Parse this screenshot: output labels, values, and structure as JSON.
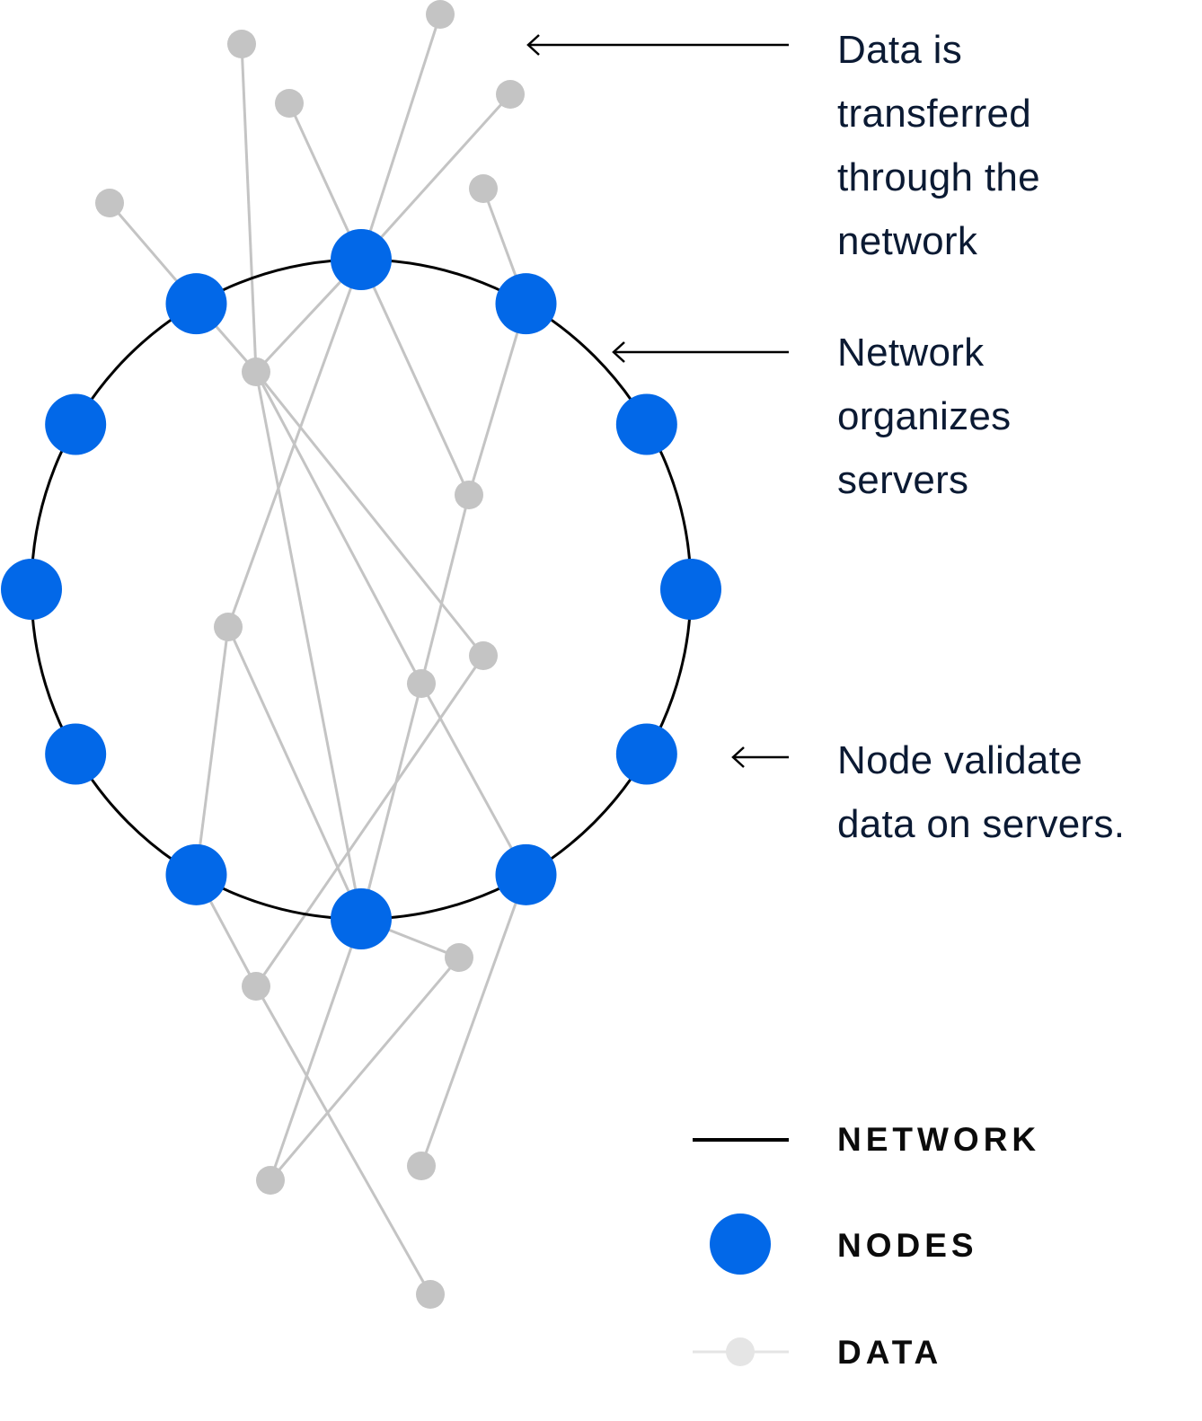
{
  "colors": {
    "network": "#000000",
    "node": "#0268E8",
    "data": "#C4C4C4",
    "data_legend": "#E5E5E5",
    "text": "#0B1A33"
  },
  "annotations": [
    {
      "name": "data-transfer",
      "lines": [
        "Data is",
        "transferred",
        "through the",
        "network"
      ]
    },
    {
      "name": "network-organizes",
      "lines": [
        "Network",
        "organizes",
        "servers"
      ]
    },
    {
      "name": "node-validate",
      "lines": [
        "Node validate",
        "data on servers."
      ]
    }
  ],
  "legend": [
    {
      "key": "network",
      "label": "NETWORK",
      "icon": "line"
    },
    {
      "key": "nodes",
      "label": "NODES",
      "icon": "dot"
    },
    {
      "key": "data",
      "label": "DATA",
      "icon": "line-dot"
    }
  ],
  "diagram": {
    "node_count": 12,
    "data_point_count": 16,
    "data_links": [
      [
        "D3",
        "N0"
      ],
      [
        "N0",
        "D8"
      ],
      [
        "D6",
        "N1"
      ],
      [
        "N1",
        "D8"
      ],
      [
        "D8",
        "D11"
      ],
      [
        "D4",
        "N0"
      ],
      [
        "N0",
        "D7"
      ],
      [
        "D1",
        "N0"
      ],
      [
        "N0",
        "D9"
      ],
      [
        "D5",
        "N11"
      ],
      [
        "N11",
        "D7"
      ],
      [
        "D2",
        "D7"
      ],
      [
        "D7",
        "N6"
      ],
      [
        "D7",
        "D11"
      ],
      [
        "D7",
        "D10"
      ],
      [
        "D9",
        "N7"
      ],
      [
        "D9",
        "N6"
      ],
      [
        "D11",
        "N6"
      ],
      [
        "D11",
        "N5"
      ],
      [
        "D10",
        "D12"
      ],
      [
        "N7",
        "D12"
      ],
      [
        "D12",
        "D16"
      ],
      [
        "N6",
        "D13"
      ],
      [
        "D13",
        "D14"
      ],
      [
        "N6",
        "D14"
      ],
      [
        "N5",
        "D15"
      ]
    ]
  }
}
